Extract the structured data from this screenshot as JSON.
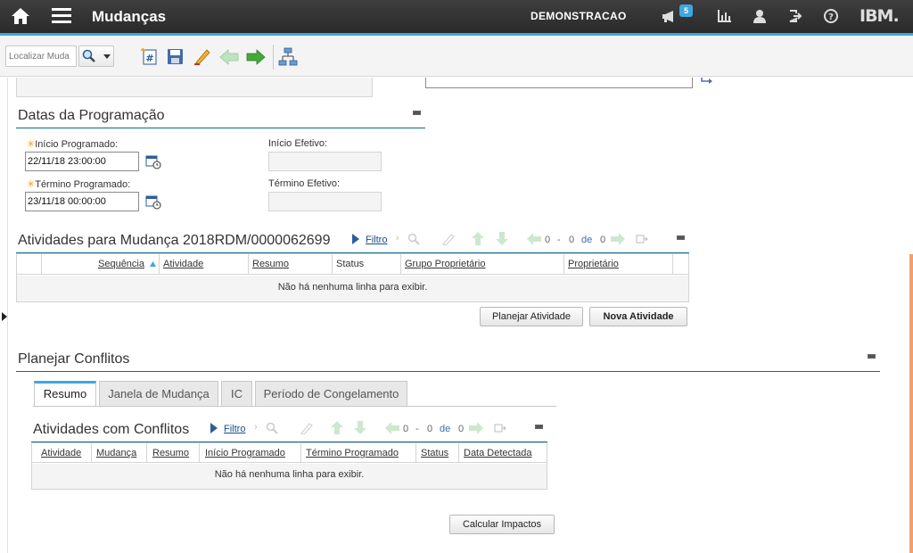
{
  "header": {
    "app_title": "Mudanças",
    "org": "DEMONSTRACAO",
    "notif_count": "5",
    "brand": "IBM."
  },
  "toolbar": {
    "search_placeholder": "Localizar Muda"
  },
  "datas": {
    "title": "Datas da Programação",
    "inicio_prog_label": "Início Programado:",
    "inicio_prog_value": "22/11/18 23:00:00",
    "termino_prog_label": "Término Programado:",
    "termino_prog_value": "23/11/18 00:00:00",
    "inicio_efet_label": "Início Efetivo:",
    "termino_efet_label": "Término Efetivo:"
  },
  "atividades": {
    "title": "Atividades para Mudança 2018RDM/0000062699",
    "filtro": "Filtro",
    "pager_from": "0",
    "pager_dash": "-",
    "pager_to": "0",
    "pager_de": "de",
    "pager_total": "0",
    "columns": [
      "Sequência",
      "Atividade",
      "Resumo",
      "Status",
      "Grupo Proprietário",
      "Proprietário"
    ],
    "empty": "Não há nenhuma linha para exibir.",
    "btn_planejar": "Planejar Atividade",
    "btn_nova": "Nova Atividade"
  },
  "conflitos": {
    "title": "Planejar Conflitos",
    "tabs": [
      "Resumo",
      "Janela de Mudança",
      "IC",
      "Período de Congelamento"
    ],
    "sub_title": "Atividades com Conflitos",
    "filtro": "Filtro",
    "pager_from": "0",
    "pager_dash": "-",
    "pager_to": "0",
    "pager_de": "de",
    "pager_total": "0",
    "columns": [
      "Atividade",
      "Mudança",
      "Resumo",
      "Início Programado",
      "Término Programado",
      "Status",
      "Data Detectada"
    ],
    "empty": "Não há nenhuma linha para exibir.",
    "btn_calcular": "Calcular Impactos"
  }
}
